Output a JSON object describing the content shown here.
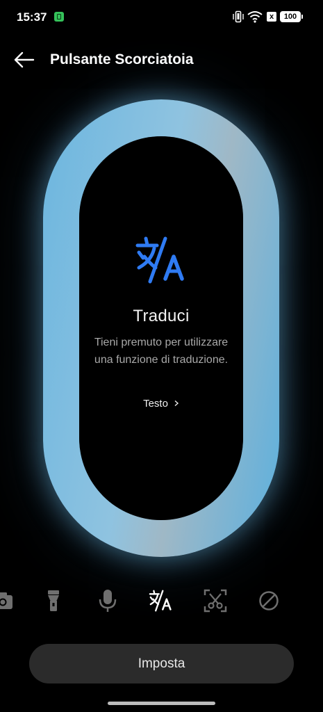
{
  "status_bar": {
    "time": "15:37",
    "battery": "100",
    "nosim": "x"
  },
  "header": {
    "title": "Pulsante Scorciatoia"
  },
  "feature": {
    "title": "Traduci",
    "description": "Tieni premuto per utilizzare una funzione di traduzione.",
    "option_label": "Testo"
  },
  "selector": {
    "items": [
      "camera-icon",
      "flashlight-icon",
      "microphone-icon",
      "translate-icon",
      "screenshot-icon",
      "disabled-icon"
    ],
    "selected": "translate-icon"
  },
  "action": {
    "set_label": "Imposta"
  },
  "colors": {
    "accent_blue": "#2f7bf3",
    "pill_blue": "#6cb6df",
    "button_bg": "#2b2b2b"
  }
}
